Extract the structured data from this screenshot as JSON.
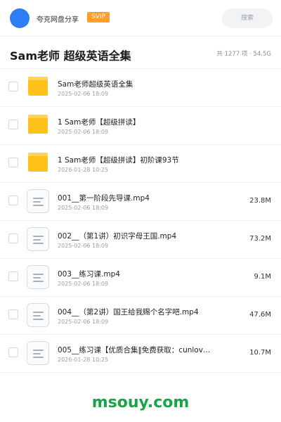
{
  "topbar": {
    "share_name": "夸克网盘分享",
    "badge": "SVIP",
    "search_label": "搜索"
  },
  "header": {
    "title": "Sam老师 超级英语全集",
    "summary": "共 1277 项 · 54.5G"
  },
  "items": [
    {
      "type": "folder",
      "name": "Sam老师超级英语全集",
      "date": "2025-02-06 18:09",
      "size": ""
    },
    {
      "type": "folder",
      "name": "1 Sam老师【超级拼读】",
      "date": "2025-02-06 18:09",
      "size": ""
    },
    {
      "type": "folder",
      "name": "1  Sam老师【超级拼读】初阶课93节",
      "date": "2026-01-28 10:25",
      "size": ""
    },
    {
      "type": "file",
      "name": "001__第一阶段先导课.mp4",
      "date": "2025-02-06 18:09",
      "size": "23.8M"
    },
    {
      "type": "file",
      "name": "002__（第1讲）初识字母王国.mp4",
      "date": "2025-02-06 18:09",
      "size": "73.2M"
    },
    {
      "type": "file",
      "name": "003__练习课.mp4",
      "date": "2025-02-06 18:09",
      "size": "9.1M"
    },
    {
      "type": "file",
      "name": "004__（第2讲）国王给我赐个名字吧.mp4",
      "date": "2025-02-06 18:09",
      "size": "47.6M"
    },
    {
      "type": "file",
      "name": "005__练习课【优质合集‖免费获取：cunlov…",
      "date": "2026-01-28 10:25",
      "size": "10.7M"
    }
  ],
  "watermark": "msouy.com"
}
